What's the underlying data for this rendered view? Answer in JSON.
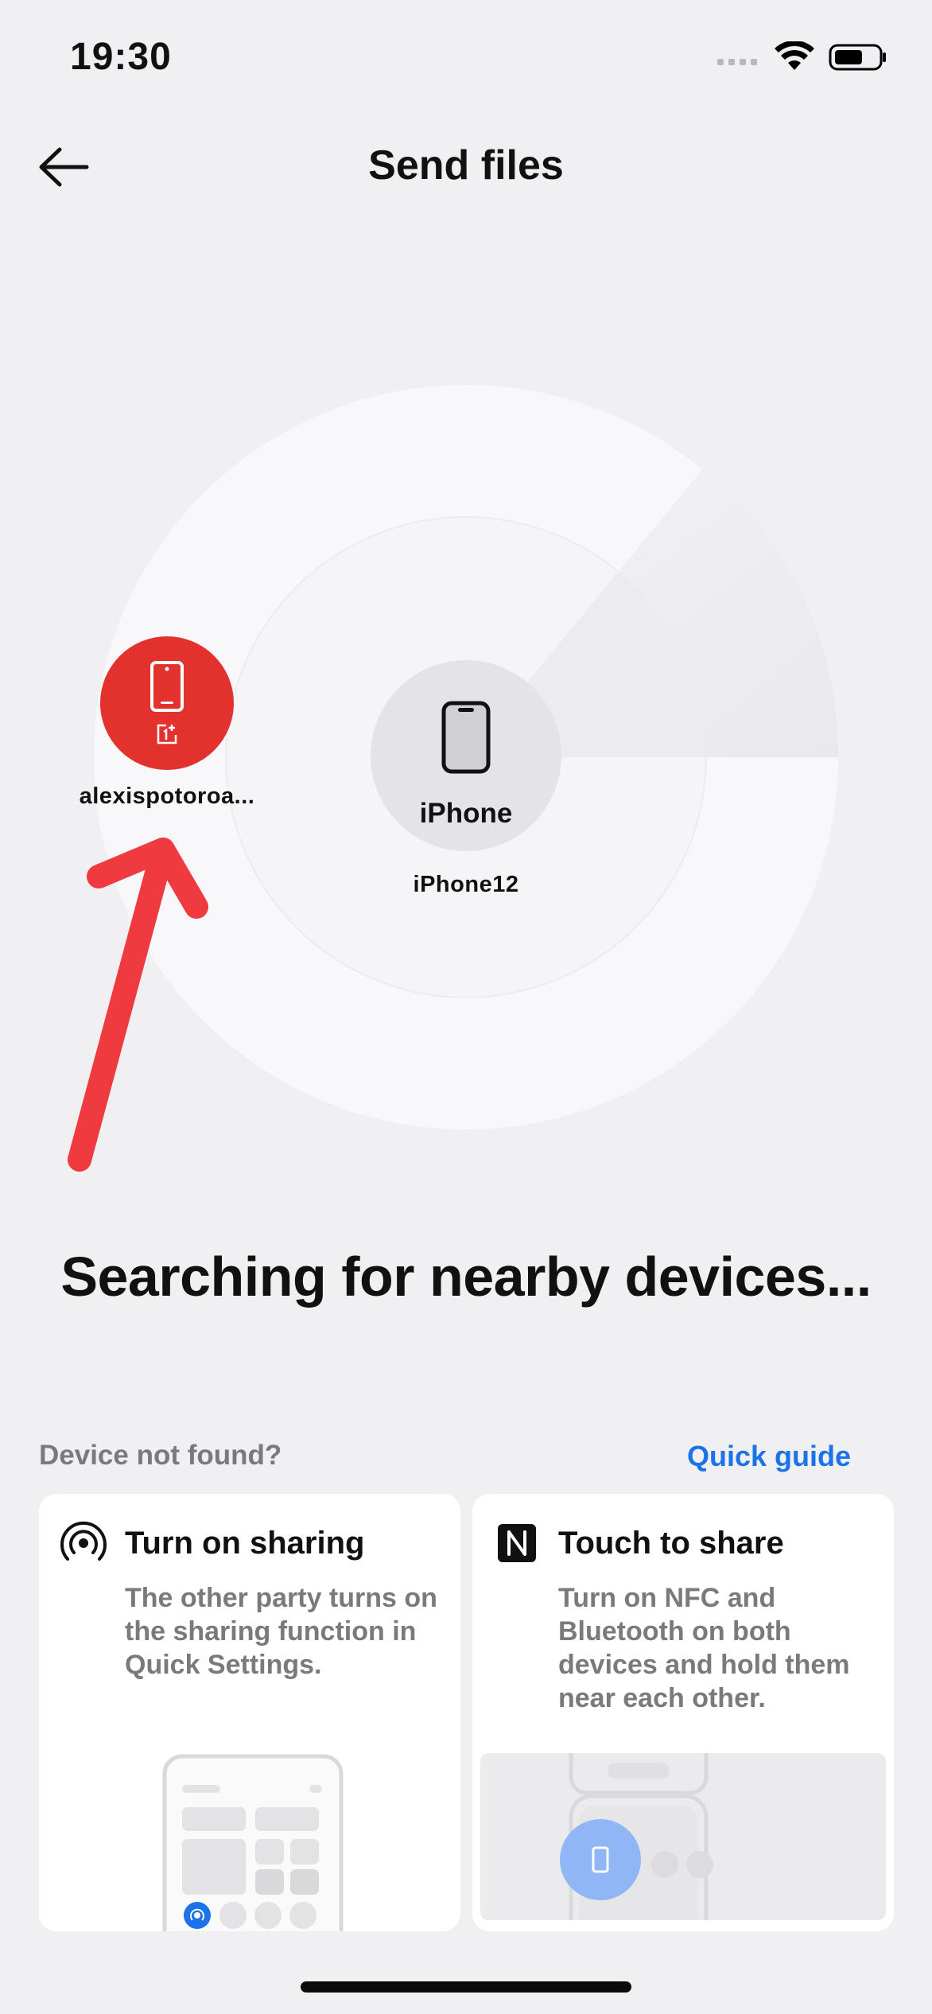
{
  "status_bar": {
    "time": "19:30"
  },
  "header": {
    "title": "Send files"
  },
  "devices": {
    "oneplus": {
      "name": "alexispotoroa..."
    },
    "iphone": {
      "label": "iPhone",
      "name": "iPhone12"
    }
  },
  "searching_text": "Searching for nearby devices...",
  "help": {
    "prompt": "Device not found?",
    "link": "Quick guide"
  },
  "cards": [
    {
      "title": "Turn on sharing",
      "description": "The other party turns on the sharing function in Quick Settings.",
      "icon": "sharing-icon"
    },
    {
      "title": "Touch to share",
      "description": "Turn on NFC and Bluetooth on both devices and hold them near each other.",
      "icon": "nfc-icon"
    }
  ],
  "colors": {
    "background": "#f0f0f3",
    "accent": "#1a73e8",
    "device_red": "#e3322e",
    "arrow": "#ef3b3f"
  }
}
